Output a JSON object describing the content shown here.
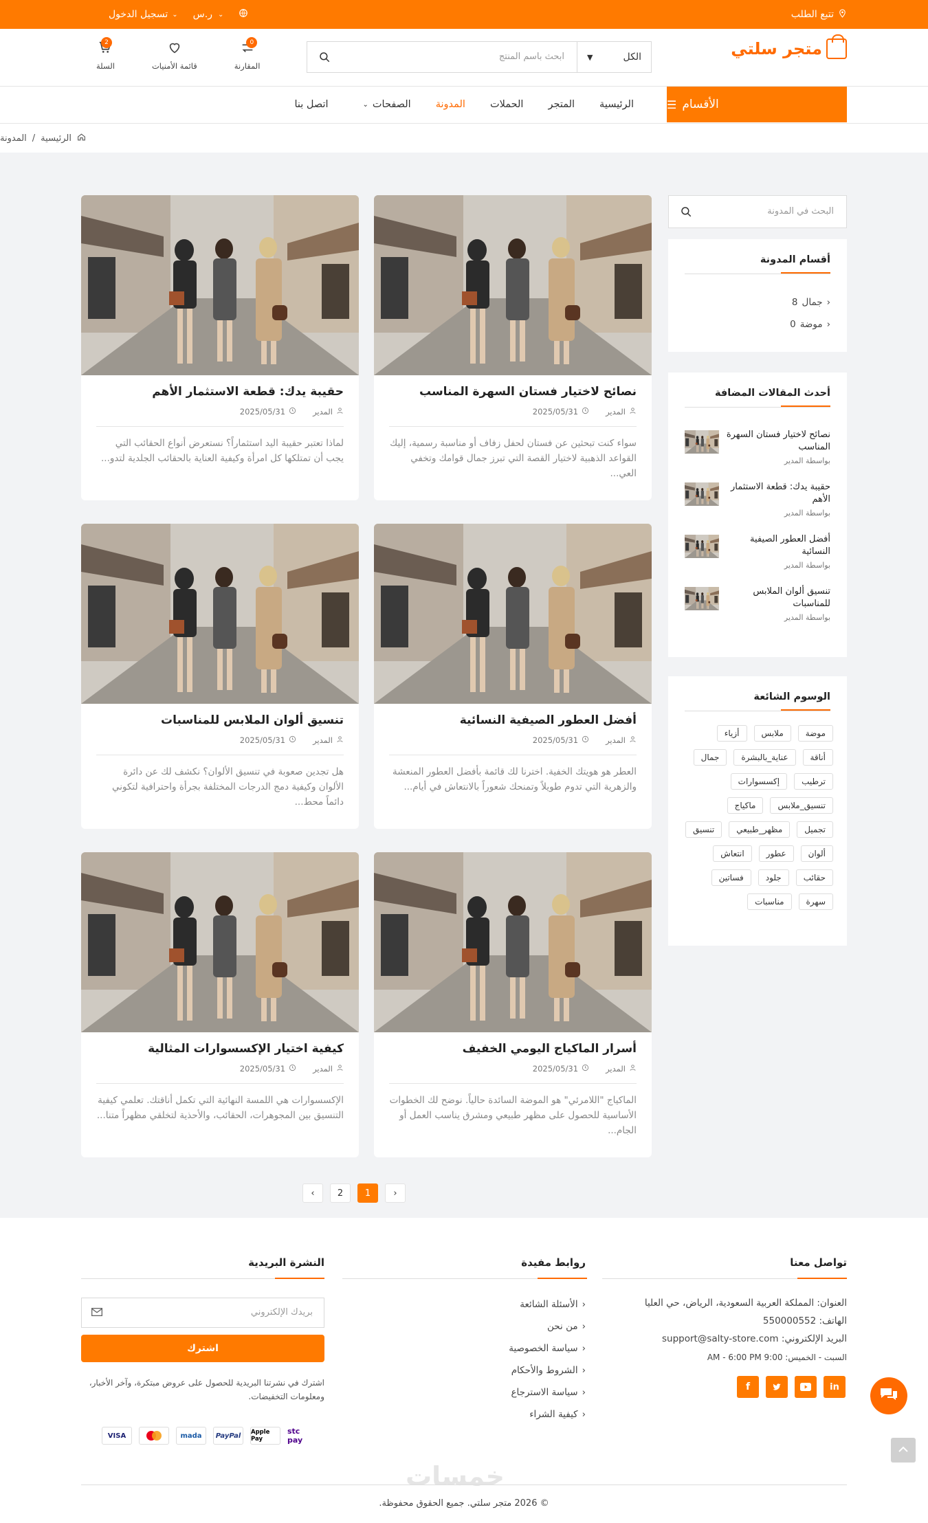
{
  "topbar": {
    "track_order": "تتبع الطلب",
    "login": "تسجيل الدخول",
    "currency": "ر.س"
  },
  "header": {
    "logo_text": "متجر سلتي",
    "search_placeholder": "ابحث باسم المنتج",
    "search_category": "الكل",
    "compare_label": "المقارنة",
    "compare_count": "0",
    "wishlist_label": "قائمة الأمنيات",
    "cart_label": "السلة",
    "cart_count": "2"
  },
  "nav": {
    "categories_label": "الأقسام",
    "links": [
      "الرئيسية",
      "المتجر",
      "الحملات",
      "المدونة",
      "الصفحات",
      "اتصل بنا"
    ]
  },
  "breadcrumb": {
    "home": "الرئيسية",
    "sep": "/",
    "current": "المدونة"
  },
  "sidebar": {
    "search_placeholder": "البحث في المدونة",
    "categories_title": "أقسام المدونة",
    "categories": [
      {
        "name": "جمال",
        "count": "8"
      },
      {
        "name": "موضة",
        "count": "0"
      }
    ],
    "recent_title": "أحدث المقالات المضافة",
    "recent": [
      {
        "title": "نصائح لاختيار فستان السهرة المناسب",
        "by": "بواسطة المدير"
      },
      {
        "title": "حقيبة يدك: قطعة الاستثمار الأهم",
        "by": "بواسطة المدير"
      },
      {
        "title": "أفضل العطور الصيفية النسائية",
        "by": "بواسطة المدير"
      },
      {
        "title": "تنسيق ألوان الملابس للمناسبات",
        "by": "بواسطة المدير"
      }
    ],
    "tags_title": "الوسوم الشائعة",
    "tags": [
      "موضة",
      "ملابس",
      "أزياء",
      "أناقة",
      "عناية_بالبشرة",
      "جمال",
      "ترطيب",
      "إكسسوارات",
      "تنسيق_ملابس",
      "ماكياج",
      "تجميل",
      "مظهر_طبيعي",
      "تنسيق",
      "ألوان",
      "عطور",
      "انتعاش",
      "حقائب",
      "جلود",
      "فساتين",
      "سهرة",
      "مناسبات"
    ]
  },
  "posts": [
    {
      "title": "نصائح لاختيار فستان السهرة المناسب",
      "author": "المدير",
      "date": "2025/05/31",
      "excerpt": "سواء كنت تبحثين عن فستان لحفل زفاف أو مناسبة رسمية، إليك القواعد الذهبية لاختيار القصة التي تبرز جمال قوامك وتخفي العي..."
    },
    {
      "title": "حقيبة يدك: قطعة الاستثمار الأهم",
      "author": "المدير",
      "date": "2025/05/31",
      "excerpt": "لماذا تعتبر حقيبة اليد استثماراً؟ نستعرض أنواع الحقائب التي يجب أن تمتلكها كل امرأة وكيفية العناية بالحقائب الجلدية لتدو..."
    },
    {
      "title": "أفضل العطور الصيفية النسائية",
      "author": "المدير",
      "date": "2025/05/31",
      "excerpt": "العطر هو هويتك الخفية. اخترنا لك قائمة بأفضل العطور المنعشة والزهرية التي تدوم طويلاً وتمنحك شعوراً بالانتعاش في أيام..."
    },
    {
      "title": "تنسيق ألوان الملابس للمناسبات",
      "author": "المدير",
      "date": "2025/05/31",
      "excerpt": "هل تجدين صعوبة في تنسيق الألوان؟ نكشف لك عن دائرة الألوان وكيفية دمج الدرجات المختلفة بجرأة واحترافية لتكوني دائماً محط..."
    },
    {
      "title": "أسرار الماكياج اليومي الخفيف",
      "author": "المدير",
      "date": "2025/05/31",
      "excerpt": "الماكياج \"اللامرئي\" هو الموضة السائدة حالياً. نوضح لك الخطوات الأساسية للحصول على مظهر طبيعي ومشرق يناسب العمل أو الجام..."
    },
    {
      "title": "كيفية اختيار الإكسسوارات المثالية",
      "author": "المدير",
      "date": "2025/05/31",
      "excerpt": "الإكسسوارات هي اللمسة النهائية التي تكمل أناقتك. تعلمي كيفية التنسيق بين المجوهرات، الحقائب، والأحذية لتخلقي مظهراً متنا..."
    }
  ],
  "pagination": {
    "prev": "‹",
    "pages": [
      "1",
      "2"
    ],
    "next": "›",
    "active": "1"
  },
  "footer": {
    "contact_title": "تواصل معنا",
    "address": "العنوان: المملكة العربية السعودية، الرياض، حي العليا",
    "phone": "الهاتف: 550000552",
    "email": "البريد الإلكتروني: support@salty-store.com",
    "hours": "السبت - الخميس: 9:00 AM - 6:00 PM",
    "links_title": "روابط مفيدة",
    "links": [
      "الأسئلة الشائعة",
      "من نحن",
      "سياسة الخصوصية",
      "الشروط والأحكام",
      "سياسة الاسترجاع",
      "كيفية الشراء"
    ],
    "newsletter_title": "النشرة البريدية",
    "newsletter_placeholder": "بريدك الإلكتروني",
    "subscribe_label": "اشترك",
    "newsletter_text": "اشترك في نشرتنا البريدية للحصول على عروض مبتكرة، وآخر الأخبار، ومعلومات التخفيضات.",
    "payments": [
      "VISA",
      "mastercard",
      "mada",
      "PayPal",
      "Apple Pay",
      "stc pay"
    ],
    "watermark": "خمسات",
    "copyright": "© 2026 متجر سلتي. جميع الحقوق محفوظة."
  },
  "colors": {
    "accent": "#ff7a00",
    "page_bg": "#f2f3f5"
  }
}
